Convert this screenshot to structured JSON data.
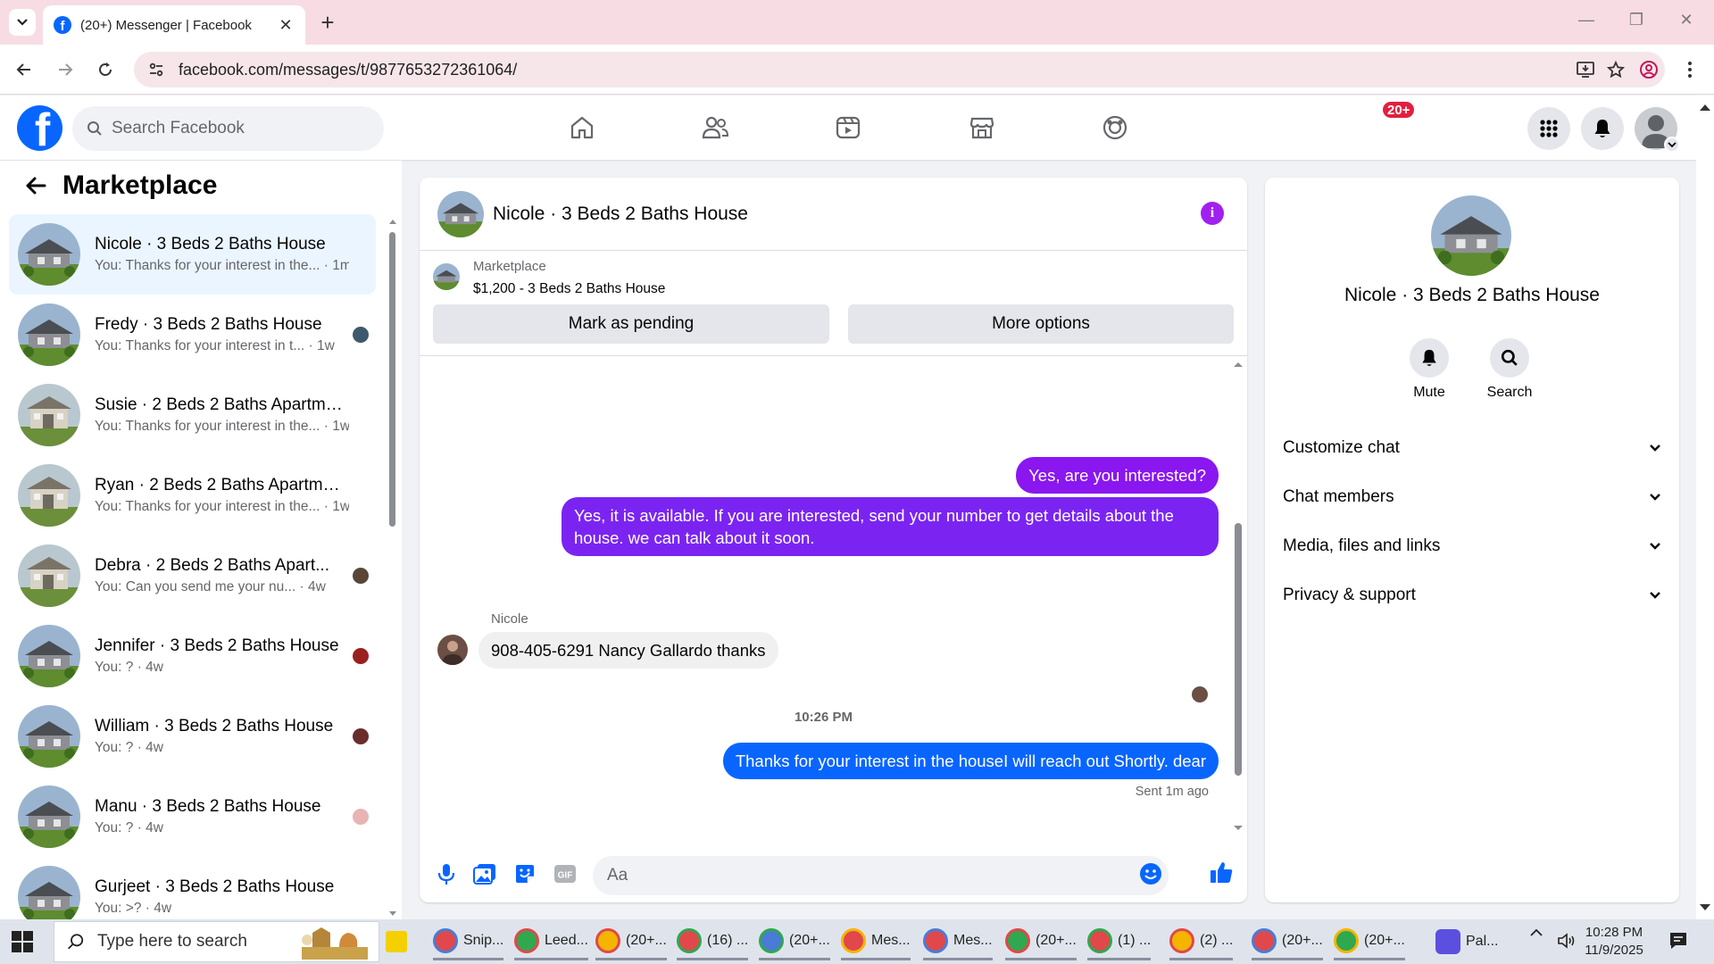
{
  "browser": {
    "tab_title": "(20+) Messenger | Facebook",
    "url": "facebook.com/messages/t/9877653272361064/"
  },
  "fb": {
    "search_placeholder": "Search Facebook",
    "notif_badge": "20+"
  },
  "sidebar": {
    "title": "Marketplace",
    "conversations": [
      {
        "name": "Nicole · 3 Beds 2 Baths House",
        "preview": "You: Thanks for your interest in the... · 1m",
        "active": true
      },
      {
        "name": "Fredy · 3 Beds 2 Baths House",
        "preview": "You: Thanks for your interest in t... · 1w"
      },
      {
        "name": "Susie · 2 Beds 2 Baths Apartmen...",
        "preview": "You: Thanks for your interest in the... · 1w"
      },
      {
        "name": "Ryan · 2 Beds 2 Baths Apartmen...",
        "preview": "You: Thanks for your interest in the... · 1w"
      },
      {
        "name": "Debra · 2 Beds 2 Baths Apart...",
        "preview": "You: Can you send me your nu... · 4w"
      },
      {
        "name": "Jennifer · 3 Beds 2 Baths House",
        "preview": "You: ? · 4w"
      },
      {
        "name": "William · 3 Beds 2 Baths House",
        "preview": "You: ? · 4w"
      },
      {
        "name": "Manu · 3 Beds 2 Baths House",
        "preview": "You: ? · 4w"
      },
      {
        "name": "Gurjeet · 3 Beds 2 Baths House",
        "preview": "You: >? · 4w"
      }
    ]
  },
  "chat": {
    "title": "Nicole · 3 Beds 2 Baths House",
    "marketplace_label": "Marketplace",
    "listing": "$1,200 - 3 Beds 2 Baths House",
    "mark_pending": "Mark as pending",
    "more_options": "More options",
    "messages": {
      "m1": "Yes, are you interested?",
      "m2_line1": "Yes, it is available. If you are interested, send your number to get details about the",
      "m2_line2": "house. we can talk about it soon.",
      "sender": "Nicole",
      "m3": "908-405-6291 Nancy Gallardo thanks",
      "timestamp": "10:26 PM",
      "m4": "Thanks for your interest in the houseI will reach out Shortly. dear",
      "status": "Sent 1m ago"
    },
    "composer_placeholder": "Aa"
  },
  "info_panel": {
    "name": "Nicole · 3 Beds 2 Baths House",
    "mute": "Mute",
    "search": "Search",
    "sections": [
      "Customize chat",
      "Chat members",
      "Media, files and links",
      "Privacy & support"
    ]
  },
  "taskbar": {
    "search_placeholder": "Type here to search",
    "items": [
      "Snip...",
      "Leed...",
      "(20+...",
      "(16) ...",
      "(20+...",
      "Mes...",
      "Mes...",
      "(20+...",
      "(1) ...",
      "(2) ...",
      "(20+...",
      "(20+...",
      "Pal..."
    ],
    "time": "10:28 PM",
    "date": "11/9/2025"
  },
  "colors": {
    "fb_blue": "#0866ff",
    "purple_bubble": "#8a16f0",
    "info_icon": "#a020f0",
    "badge_red": "#e41e3f"
  }
}
